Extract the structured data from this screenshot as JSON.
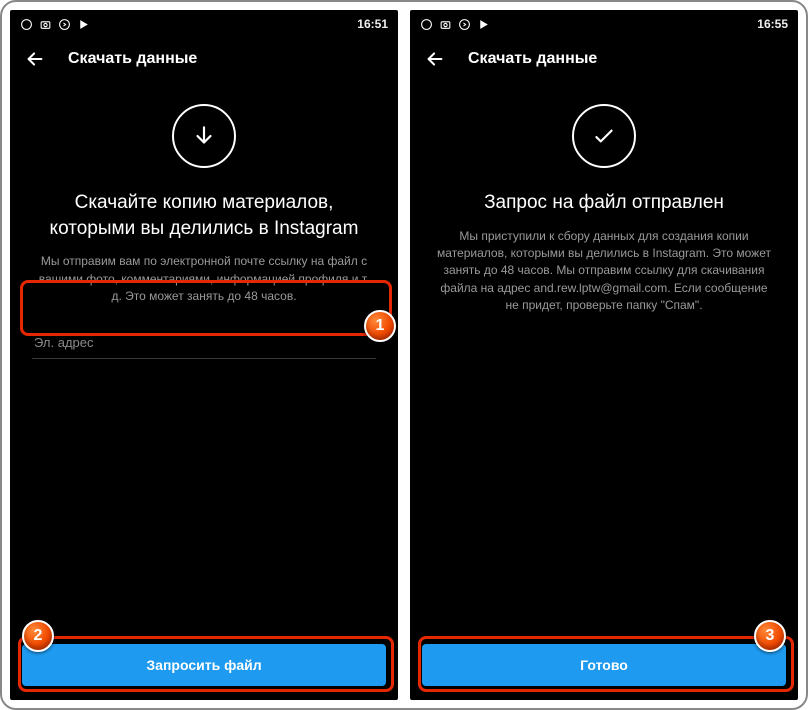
{
  "screens": {
    "left": {
      "statusbar_time": "16:51",
      "nav_title": "Скачать данные",
      "icon": "arrow-down",
      "heading": "Скачайте копию материалов, которыми вы делились в Instagram",
      "description": "Мы отправим вам по электронной почте ссылку на файл с вашими фото, комментариями, информацией профиля и т. д. Это может занять до 48 часов.",
      "email_placeholder": "Эл. адрес",
      "button_label": "Запросить файл"
    },
    "right": {
      "statusbar_time": "16:55",
      "nav_title": "Скачать данные",
      "icon": "check",
      "heading": "Запрос на файл отправлен",
      "description": "Мы приступили к сбору данных для создания копии материалов, которыми вы делились в Instagram. Это может занять до 48 часов. Мы отправим ссылку для скачивания файла на адрес and.rew.lptw@gmail.com. Если сообщение не придет, проверьте папку \"Спам\".",
      "button_label": "Готово"
    }
  },
  "annotations": {
    "marker1": "1",
    "marker2": "2",
    "marker3": "3"
  },
  "colors": {
    "primary": "#1e9bf0",
    "highlight": "#e52800"
  }
}
